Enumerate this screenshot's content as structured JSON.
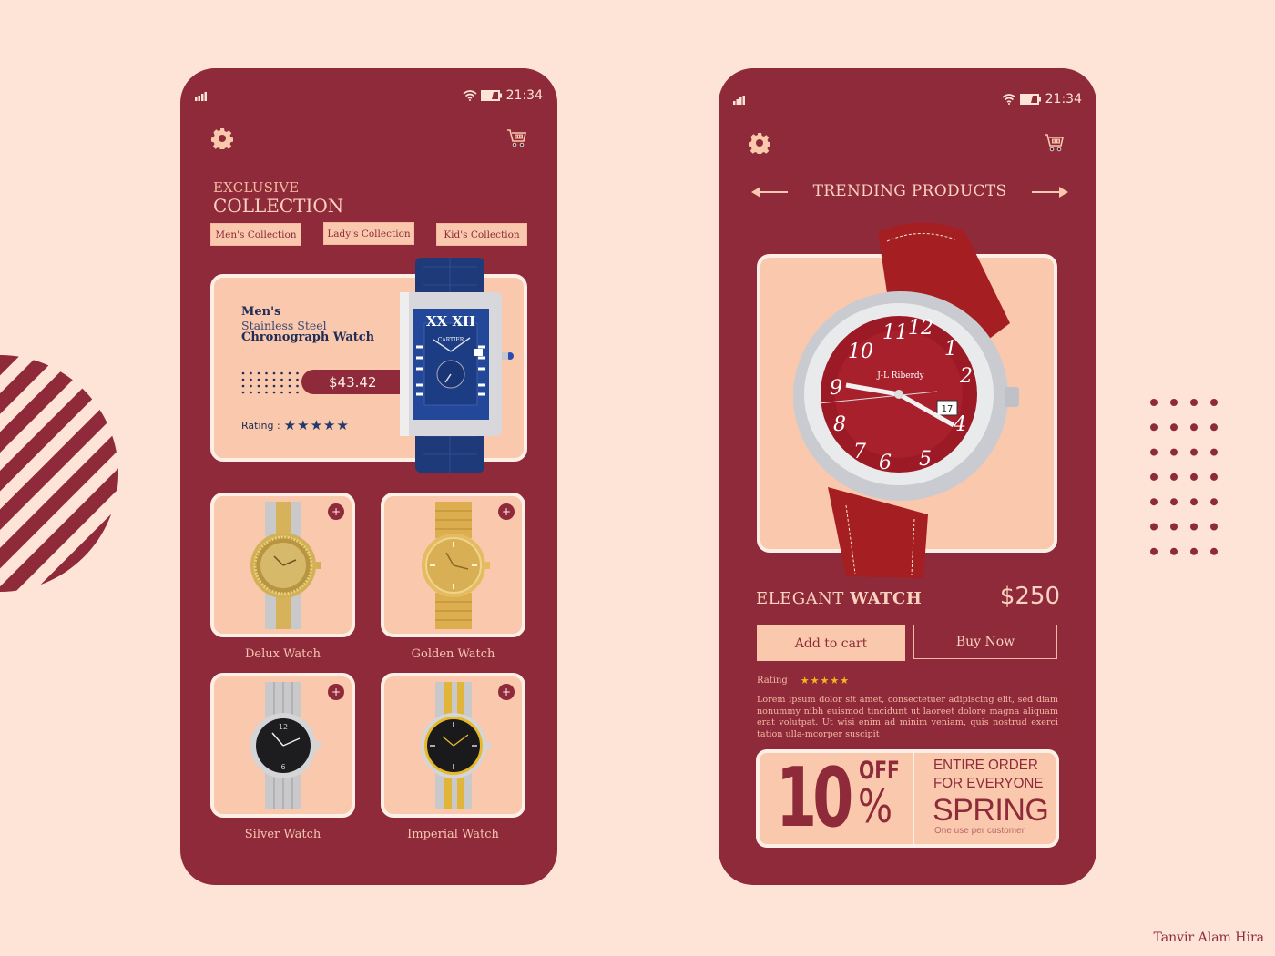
{
  "colors": {
    "background": "#fde4d6",
    "phone": "#8e2a3a",
    "card": "#f9c8ad",
    "card_border": "#fdeee6",
    "navy_text": "#1f2c57",
    "gold_star": "#f2b61f"
  },
  "status_bar": {
    "time": "21:34",
    "icons": [
      "signal-icon",
      "wifi-icon",
      "battery-icon"
    ]
  },
  "left_screen": {
    "header_icons": [
      "gear-icon",
      "cart-icon"
    ],
    "eyebrow": "EXCLUSIVE",
    "headline": "COLLECTION",
    "tabs": [
      {
        "label": "Men's Collection"
      },
      {
        "label": "Lady's Collection"
      },
      {
        "label": "Kid's Collection"
      }
    ],
    "featured": {
      "line1": "Men's",
      "line2": "Stainless Steel",
      "line3": "Chronograph Watch",
      "price": "$43.42",
      "rating_label": "Rating :",
      "rating": 5,
      "rating_max": 5,
      "stars": "★★★★★"
    },
    "products": [
      {
        "name": "Delux Watch",
        "add": "+"
      },
      {
        "name": "Golden Watch",
        "add": "+"
      },
      {
        "name": "Silver Watch",
        "add": "+"
      },
      {
        "name": "Imperial Watch",
        "add": "+"
      }
    ]
  },
  "right_screen": {
    "header_icons": [
      "gear-icon",
      "cart-icon"
    ],
    "section_title": "TRENDING PRODUCTS",
    "product": {
      "name_regular": "ELEGANT ",
      "name_bold": "WATCH",
      "price": "$250",
      "add_to_cart": "Add to cart",
      "buy_now": "Buy Now",
      "rating_label": "Rating",
      "rating": 5,
      "rating_max": 5,
      "stars": "★★★★★",
      "description": "Lorem ipsum dolor sit amet, consectetuer adipiscing elit, sed diam nonummy nibh euismod tincidunt ut laoreet dolore magna aliquam erat volutpat. Ut wisi enim ad minim veniam, quis nostrud exerci tation ulla-mcorper suscipit"
    },
    "coupon": {
      "amount": "10",
      "off": "OFF",
      "percent": "%",
      "line1": "ENTIRE ORDER",
      "line2": "FOR EVERYONE",
      "code": "SPRING",
      "note": "One use per customer"
    }
  },
  "credit": "Tanvir Alam Hira"
}
